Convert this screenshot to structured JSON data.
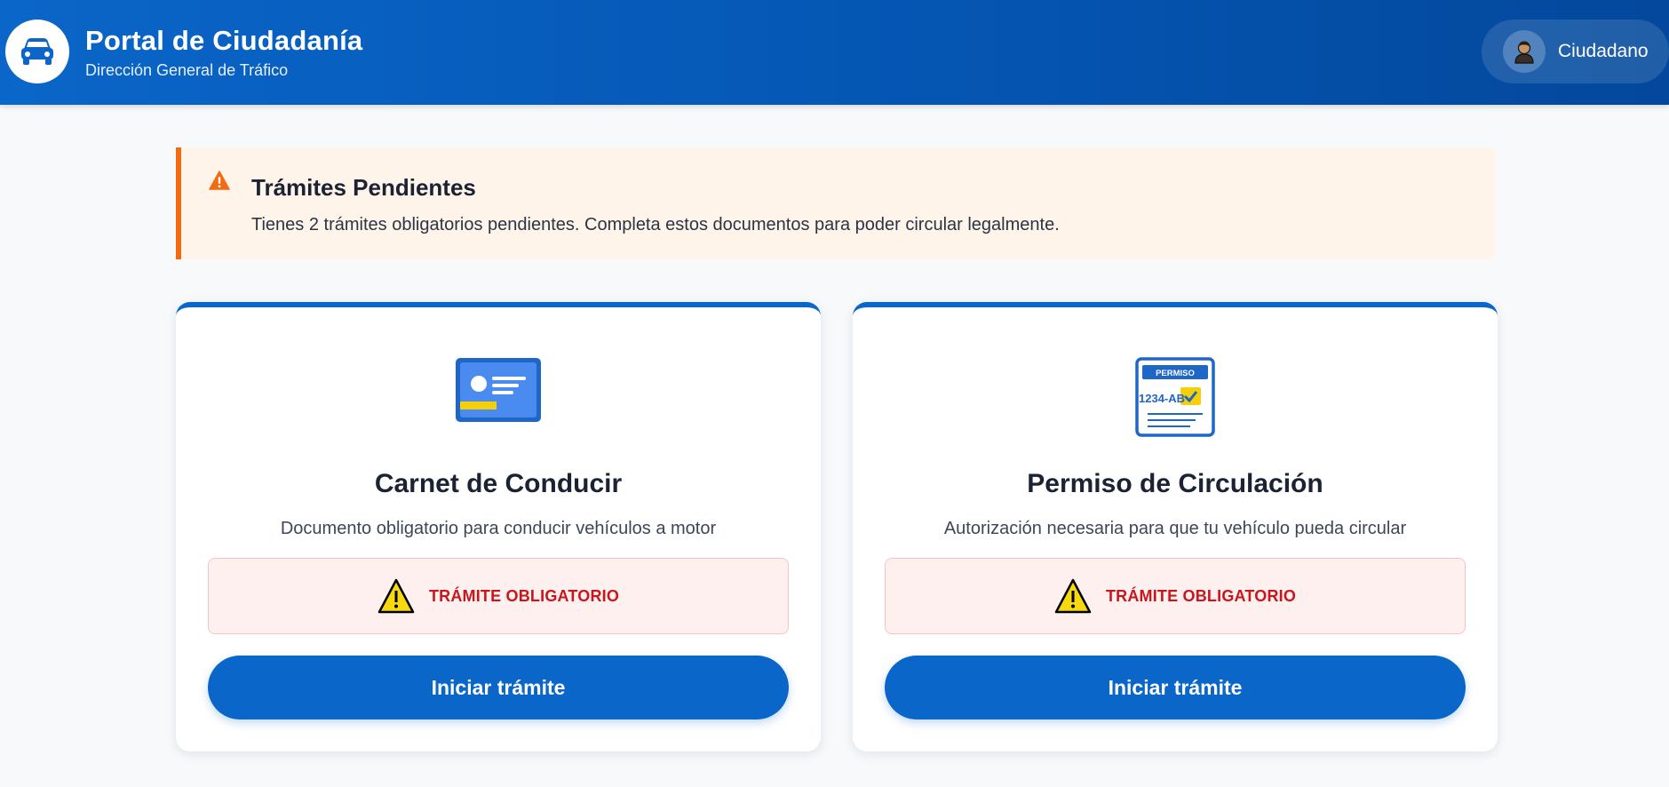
{
  "header": {
    "title": "Portal de Ciudadanía",
    "subtitle": "Dirección General de Tráfico",
    "logo_icon": "car-icon",
    "user": {
      "name": "Ciudadano",
      "icon": "user-avatar-icon"
    }
  },
  "alert": {
    "icon": "warning-icon",
    "title": "Trámites Pendientes",
    "text": "Tienes 2 trámites obligatorios pendientes. Completa estos documentos para poder circular legalmente.",
    "accent_color": "#f26a12"
  },
  "cards": [
    {
      "icon": "driver-license-icon",
      "title": "Carnet de Conducir",
      "description": "Documento obligatorio para conducir vehículos a motor",
      "badge": "TRÁMITE OBLIGATORIO",
      "button": "Iniciar trámite"
    },
    {
      "icon": "circulation-permit-icon",
      "icon_texts": {
        "header": "PERMISO",
        "plate": "1234-AB"
      },
      "title": "Permiso de Circulación",
      "description": "Autorización necesaria para que tu vehículo pueda circular",
      "badge": "TRÁMITE OBLIGATORIO",
      "button": "Iniciar trámite"
    }
  ],
  "colors": {
    "primary": "#0a66c8",
    "danger": "#c8161d",
    "warning": "#f26a12"
  }
}
